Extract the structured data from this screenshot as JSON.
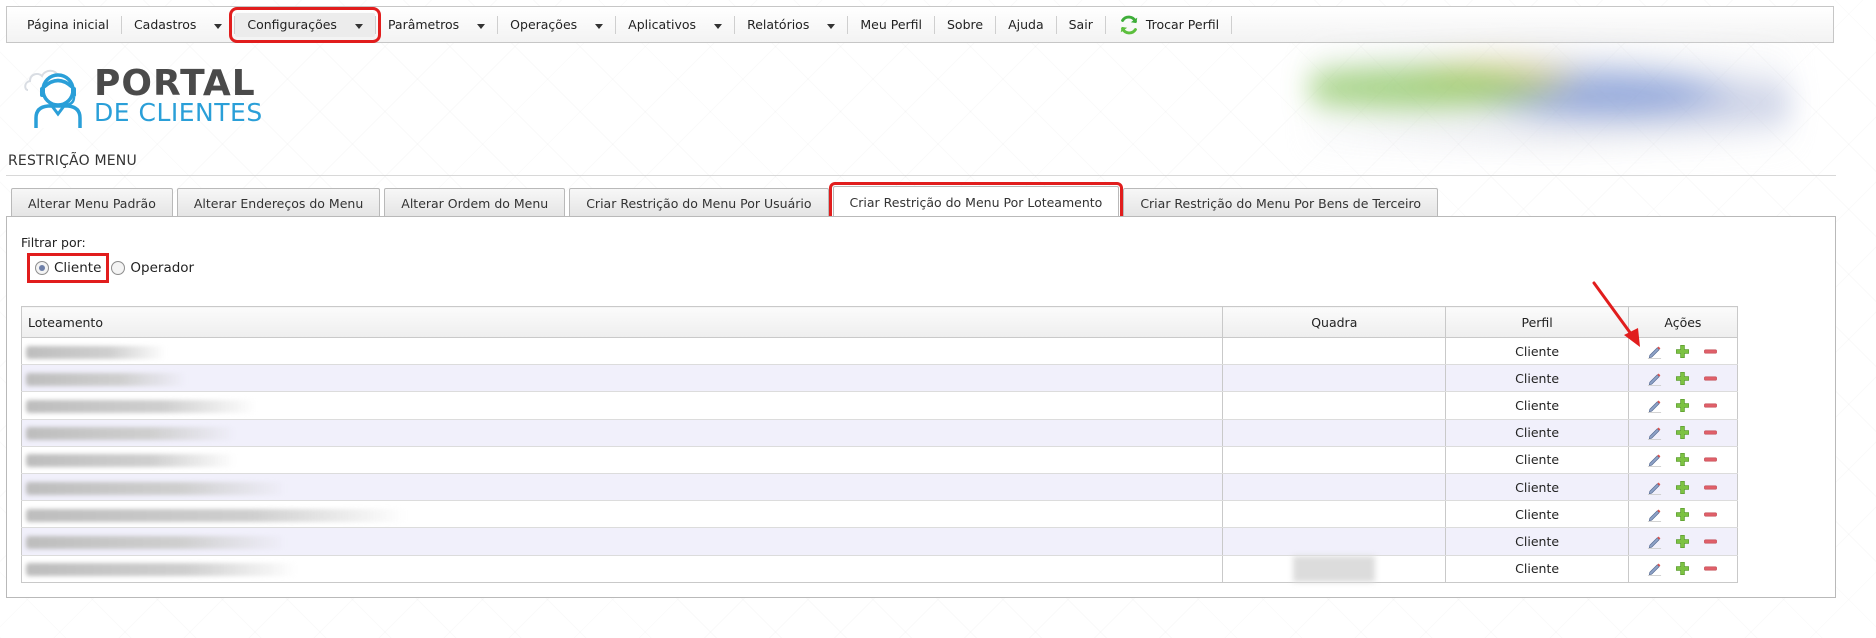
{
  "menu": {
    "items": [
      {
        "label": "Página inicial",
        "has_dropdown": false
      },
      {
        "label": "Cadastros",
        "has_dropdown": true
      },
      {
        "label": "Configurações",
        "has_dropdown": true,
        "highlighted": true
      },
      {
        "label": "Parâmetros",
        "has_dropdown": true
      },
      {
        "label": "Operações",
        "has_dropdown": true
      },
      {
        "label": "Aplicativos",
        "has_dropdown": true
      },
      {
        "label": "Relatórios",
        "has_dropdown": true
      },
      {
        "label": "Meu Perfil",
        "has_dropdown": false
      },
      {
        "label": "Sobre",
        "has_dropdown": false
      },
      {
        "label": "Ajuda",
        "has_dropdown": false
      },
      {
        "label": "Sair",
        "has_dropdown": false
      }
    ],
    "switch_profile": {
      "label": "Trocar Perfil",
      "icon": "refresh-icon"
    }
  },
  "logo": {
    "line1": "PORTAL",
    "line2": "DE CLIENTES"
  },
  "page_title": "RESTRIÇÃO MENU",
  "tabs": [
    {
      "label": "Alterar Menu Padrão"
    },
    {
      "label": "Alterar Endereços do Menu"
    },
    {
      "label": "Alterar Ordem do Menu"
    },
    {
      "label": "Criar Restrição do Menu Por Usuário"
    },
    {
      "label": "Criar Restrição do Menu Por Loteamento",
      "active": true
    },
    {
      "label": "Criar Restrição do Menu Por Bens de Terceiro"
    }
  ],
  "filter": {
    "label": "Filtrar por:",
    "options": [
      {
        "label": "Cliente",
        "checked": true
      },
      {
        "label": "Operador",
        "checked": false
      }
    ]
  },
  "table": {
    "columns": [
      "Loteamento",
      "Quadra",
      "Perfil",
      "Ações"
    ],
    "rows": [
      {
        "loteamento": "",
        "quadra": "",
        "perfil": "Cliente"
      },
      {
        "loteamento": "",
        "quadra": "",
        "perfil": "Cliente"
      },
      {
        "loteamento": "",
        "quadra": "",
        "perfil": "Cliente"
      },
      {
        "loteamento": "",
        "quadra": "",
        "perfil": "Cliente"
      },
      {
        "loteamento": "",
        "quadra": "",
        "perfil": "Cliente"
      },
      {
        "loteamento": "",
        "quadra": "",
        "perfil": "Cliente"
      },
      {
        "loteamento": "",
        "quadra": "",
        "perfil": "Cliente"
      },
      {
        "loteamento": "",
        "quadra": "",
        "perfil": "Cliente"
      },
      {
        "loteamento": "",
        "quadra": "",
        "perfil": "Cliente"
      }
    ],
    "action_icons": [
      "edit-icon",
      "add-icon",
      "remove-icon"
    ]
  },
  "colors": {
    "highlight": "#e11d1d",
    "logo_blue": "#2a9fd8",
    "logo_gray": "#4a4a4a",
    "row_alt": "#f1f0fb",
    "add_green": "#7cc242",
    "remove_red": "#e0606a"
  }
}
